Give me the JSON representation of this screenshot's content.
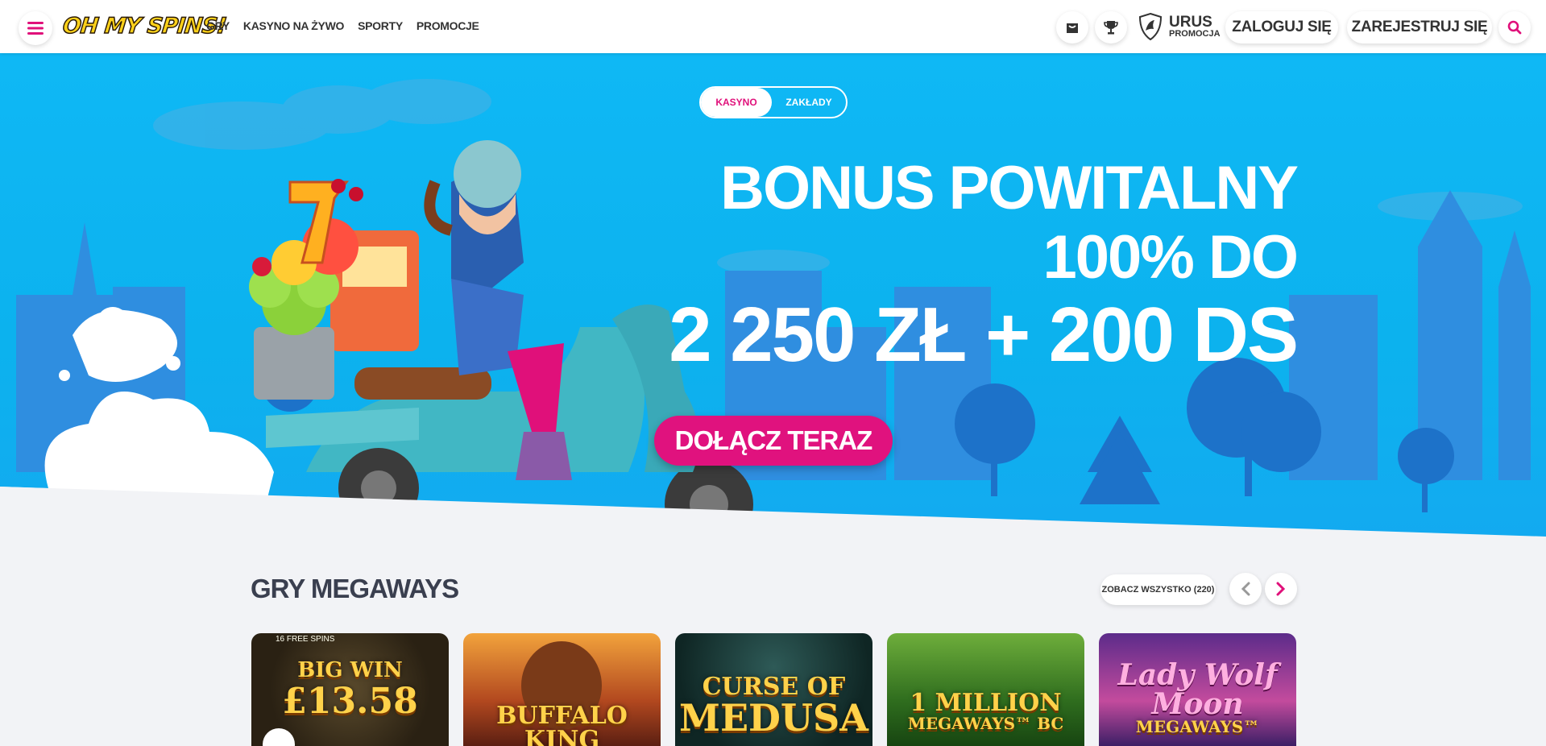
{
  "header": {
    "logo_text": "OH MY SPINS!",
    "nav": [
      "GRY",
      "KASYNO NA ŻYWO",
      "SPORTY",
      "PROMOCJE"
    ],
    "promo_title": "URUS",
    "promo_sub": "PROMOCJA",
    "login_label": "ZALOGUJ SIĘ",
    "register_label": "ZAREJESTRUJ SIĘ"
  },
  "hero": {
    "toggle_on": "KASYNO",
    "toggle_off": "ZAKŁADY",
    "line1": "BONUS POWITALNY",
    "line2": "100% DO",
    "line3": "2 250 ZŁ + 200 DS",
    "cta": "DOŁĄCZ TERAZ"
  },
  "section": {
    "title": "GRY MEGAWAYS",
    "see_all": "ZOBACZ WSZYSTKO (220)"
  },
  "games": [
    {
      "line1": "BIG WIN",
      "line2": "£13.58",
      "top": "16 FREE SPINS"
    },
    {
      "line1": "BUFFALO KING",
      "line2": ""
    },
    {
      "line1": "CURSE OF",
      "line2": "MEDUSA"
    },
    {
      "line1": "1 MILLION",
      "line2": "MEGAWAYS™ BC"
    },
    {
      "line1": "Lady Wolf",
      "line2": "Moon",
      "line3": "MEGAWAYS™"
    }
  ],
  "colors": {
    "accent": "#e0107a",
    "hero_blue": "#0fb8f5",
    "logo_yellow": "#ffd21a"
  },
  "icons": [
    "menu-icon",
    "bag-icon",
    "trophy-icon",
    "shield-icon",
    "search-icon",
    "chevron-left-icon",
    "chevron-right-icon"
  ]
}
